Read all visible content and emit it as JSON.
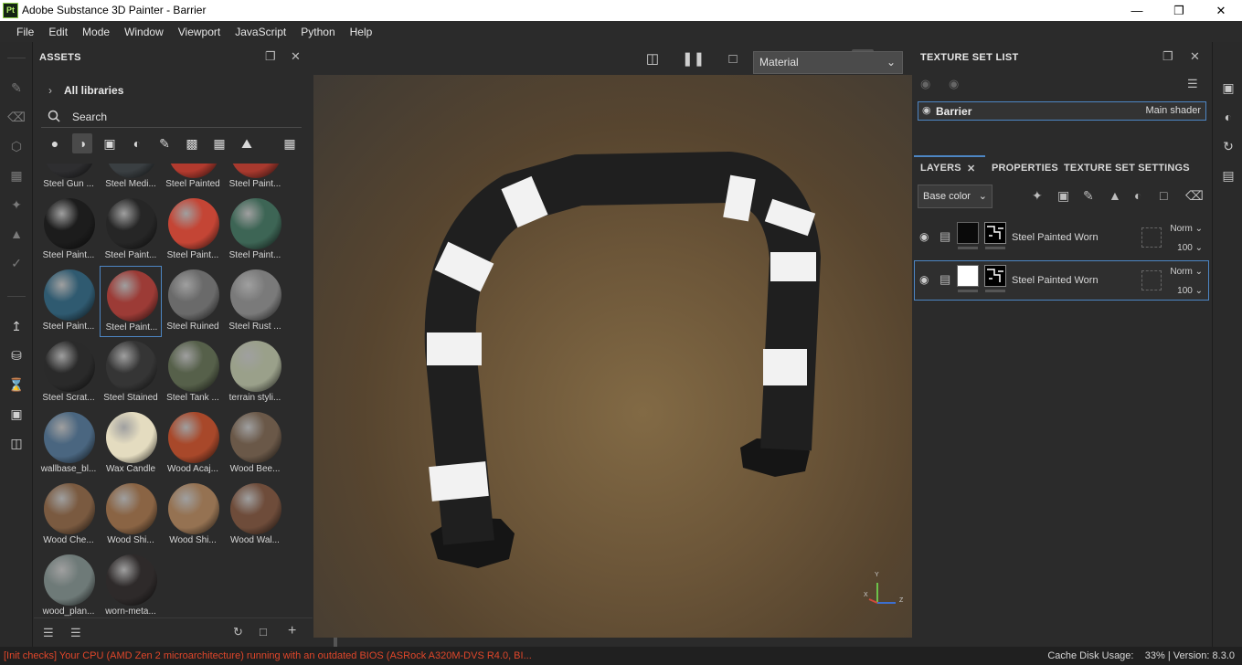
{
  "window": {
    "app_icon_text": "Pt",
    "title": "Adobe Substance 3D Painter - Barrier"
  },
  "menu": [
    "File",
    "Edit",
    "Mode",
    "Window",
    "Viewport",
    "JavaScript",
    "Python",
    "Help"
  ],
  "assets": {
    "title": "ASSETS",
    "library": "All libraries",
    "search_placeholder": "Search",
    "items": [
      {
        "label": "Steel Gun ...",
        "color": "#2e2e30"
      },
      {
        "label": "Steel Medi...",
        "color": "#3a3f42"
      },
      {
        "label": "Steel Painted",
        "color": "#b23a2e"
      },
      {
        "label": "Steel Paint...",
        "color": "#a8392e"
      },
      {
        "label": "Steel Paint...",
        "color": "#1c1c1c"
      },
      {
        "label": "Steel Paint...",
        "color": "#262626"
      },
      {
        "label": "Steel Paint...",
        "color": "#c44535"
      },
      {
        "label": "Steel Paint...",
        "color": "#3d6555"
      },
      {
        "label": "Steel Paint...",
        "color": "#2f5a70"
      },
      {
        "label": "Steel Paint...",
        "color": "#9c3b36"
      },
      {
        "label": "Steel Ruined",
        "color": "#6a6a6a"
      },
      {
        "label": "Steel Rust ...",
        "color": "#7a7a7a"
      },
      {
        "label": "Steel Scrat...",
        "color": "#2a2a2a"
      },
      {
        "label": "Steel Stained",
        "color": "#353535"
      },
      {
        "label": "Steel Tank ...",
        "color": "#56604a"
      },
      {
        "label": "terrain styli...",
        "color": "#9aa08a"
      },
      {
        "label": "wallbase_bl...",
        "color": "#4a6680"
      },
      {
        "label": "Wax Candle",
        "color": "#e4dcc0"
      },
      {
        "label": "Wood Acaj...",
        "color": "#a8482a"
      },
      {
        "label": "Wood Bee...",
        "color": "#6a5848"
      },
      {
        "label": "Wood Che...",
        "color": "#7a5a40"
      },
      {
        "label": "Wood Shi...",
        "color": "#8a6444"
      },
      {
        "label": "Wood Shi...",
        "color": "#957252"
      },
      {
        "label": "Wood Wal...",
        "color": "#6e4c3a"
      },
      {
        "label": "wood_plan...",
        "color": "#6e7a78"
      },
      {
        "label": "worn-meta...",
        "color": "#2e2a2a"
      }
    ],
    "selected_index": 9
  },
  "viewport": {
    "material_dropdown": "Material"
  },
  "texture_set_list": {
    "title": "TEXTURE SET LIST",
    "set_name": "Barrier",
    "shader": "Main shader"
  },
  "layers": {
    "tabs": [
      "LAYERS",
      "PROPERTIES",
      "TEXTURE SET SETTINGS"
    ],
    "channel": "Base color",
    "items": [
      {
        "name": "Steel Painted Worn",
        "blend": "Norm",
        "opacity": "100",
        "fill_color": "#0a0a0a"
      },
      {
        "name": "Steel Painted Worn",
        "blend": "Norm",
        "opacity": "100",
        "fill_color": "#ffffff"
      }
    ]
  },
  "status": {
    "message": "[Init checks] Your CPU (AMD Zen 2 microarchitecture) running with an outdated BIOS (ASRock A320M-DVS R4.0, BI...",
    "cache": "Cache Disk Usage:",
    "cache_value": "33%",
    "version": "| Version: 8.3.0",
    "message_color": "#e0462a"
  },
  "gizmo": {
    "y": "Y",
    "z": "Z",
    "x": "X"
  }
}
